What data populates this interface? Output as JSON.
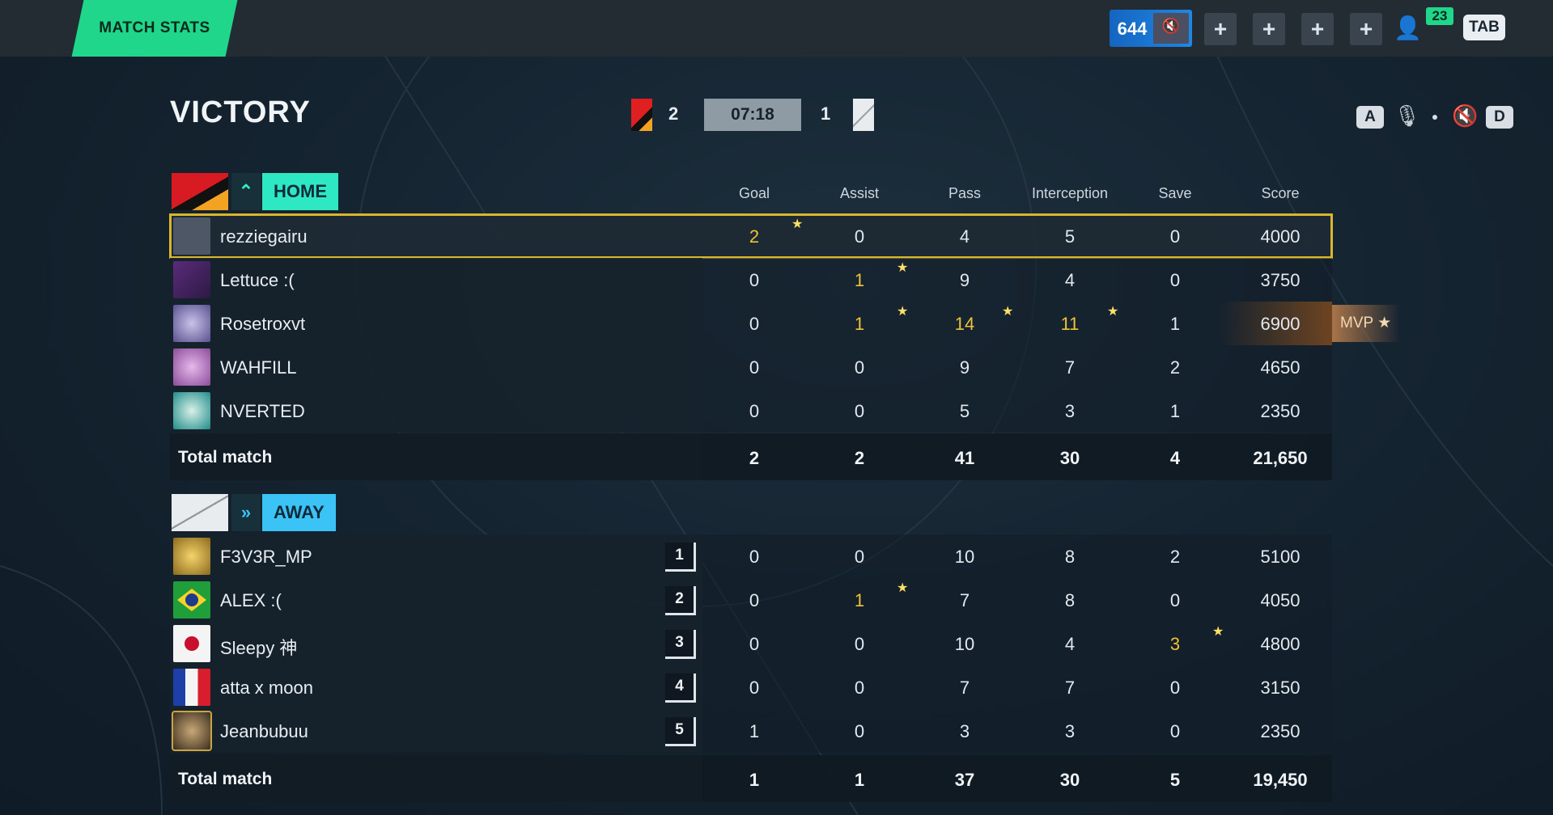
{
  "topbar": {
    "tab_label": "MATCH STATS",
    "coins": "644",
    "notification_count": "23",
    "tab_key": "TAB"
  },
  "header": {
    "result": "VICTORY",
    "home_score": "2",
    "away_score": "1",
    "clock": "07:18",
    "key_left": "A",
    "key_right": "D"
  },
  "columns": [
    "Goal",
    "Assist",
    "Pass",
    "Interception",
    "Save",
    "Score"
  ],
  "home": {
    "label": "HOME",
    "players": [
      {
        "name": "rezziegairu",
        "goal": "2",
        "assist": "0",
        "pass": "4",
        "interception": "5",
        "save": "0",
        "score": "4000"
      },
      {
        "name": "Lettuce :(",
        "goal": "0",
        "assist": "1",
        "pass": "9",
        "interception": "4",
        "save": "0",
        "score": "3750"
      },
      {
        "name": "Rosetroxvt",
        "goal": "0",
        "assist": "1",
        "pass": "14",
        "interception": "11",
        "save": "1",
        "score": "6900"
      },
      {
        "name": "WAHFILL",
        "goal": "0",
        "assist": "0",
        "pass": "9",
        "interception": "7",
        "save": "2",
        "score": "4650"
      },
      {
        "name": "NVERTED",
        "goal": "0",
        "assist": "0",
        "pass": "5",
        "interception": "3",
        "save": "1",
        "score": "2350"
      }
    ],
    "total": {
      "label": "Total match",
      "goal": "2",
      "assist": "2",
      "pass": "41",
      "interception": "30",
      "save": "4",
      "score": "21,650"
    },
    "mvp_label": "MVP"
  },
  "away": {
    "label": "AWAY",
    "players": [
      {
        "name": "F3V3R_MP",
        "rank": "1",
        "goal": "0",
        "assist": "0",
        "pass": "10",
        "interception": "8",
        "save": "2",
        "score": "5100"
      },
      {
        "name": "ALEX :(",
        "rank": "2",
        "goal": "0",
        "assist": "1",
        "pass": "7",
        "interception": "8",
        "save": "0",
        "score": "4050"
      },
      {
        "name": "Sleepy 神",
        "rank": "3",
        "goal": "0",
        "assist": "0",
        "pass": "10",
        "interception": "4",
        "save": "3",
        "score": "4800"
      },
      {
        "name": "atta x moon",
        "rank": "4",
        "goal": "0",
        "assist": "0",
        "pass": "7",
        "interception": "7",
        "save": "0",
        "score": "3150"
      },
      {
        "name": "Jeanbubuu",
        "rank": "5",
        "goal": "1",
        "assist": "0",
        "pass": "3",
        "interception": "3",
        "save": "0",
        "score": "2350"
      }
    ],
    "total": {
      "label": "Total match",
      "goal": "1",
      "assist": "1",
      "pass": "37",
      "interception": "30",
      "save": "5",
      "score": "19,450"
    }
  },
  "colors": {
    "accent": "#1fd68a",
    "highlight": "#d9b62b",
    "gold_stat": "#f0c238",
    "home_badge": "#2ee8c4",
    "away_badge": "#3cc3f5"
  }
}
